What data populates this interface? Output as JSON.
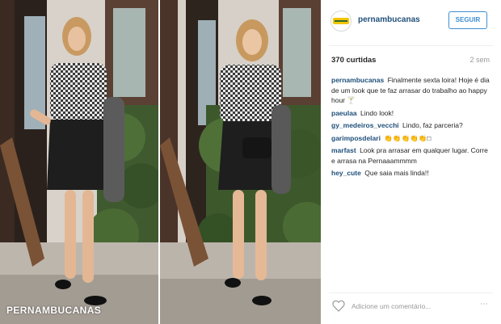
{
  "photo": {
    "watermark": "PERNAMBUCANAS"
  },
  "post": {
    "username": "pernambucanas",
    "follow_label": "SEGUIR",
    "likes": "370 curtidas",
    "time": "2 sem",
    "add_comment_placeholder": "Adicione um comentário...",
    "more_icon": "⋯"
  },
  "comments": [
    {
      "user": "pernambucanas",
      "text": "Finalmente sexta loira! Hoje é dia de um look que te faz arrasar do trabalho ao happy hour 🍸"
    },
    {
      "user": "paeulaa",
      "text": "Lindo look!"
    },
    {
      "user": "gy_medeiros_vecchi",
      "text": "Lindo, faz parceria?"
    },
    {
      "user": "garimposdelari",
      "text": "👏👏👏👏👏□"
    },
    {
      "user": "marfast",
      "text": "Look pra arrasar em qualquer lugar. Corre e arrasa na Pernaaammmm"
    },
    {
      "user": "hey_cute",
      "text": "Que saia mais linda!!"
    }
  ],
  "colors": {
    "accent": "#3f8fd2",
    "username": "#1f4f7a",
    "brand_yellow": "#f2c500"
  }
}
